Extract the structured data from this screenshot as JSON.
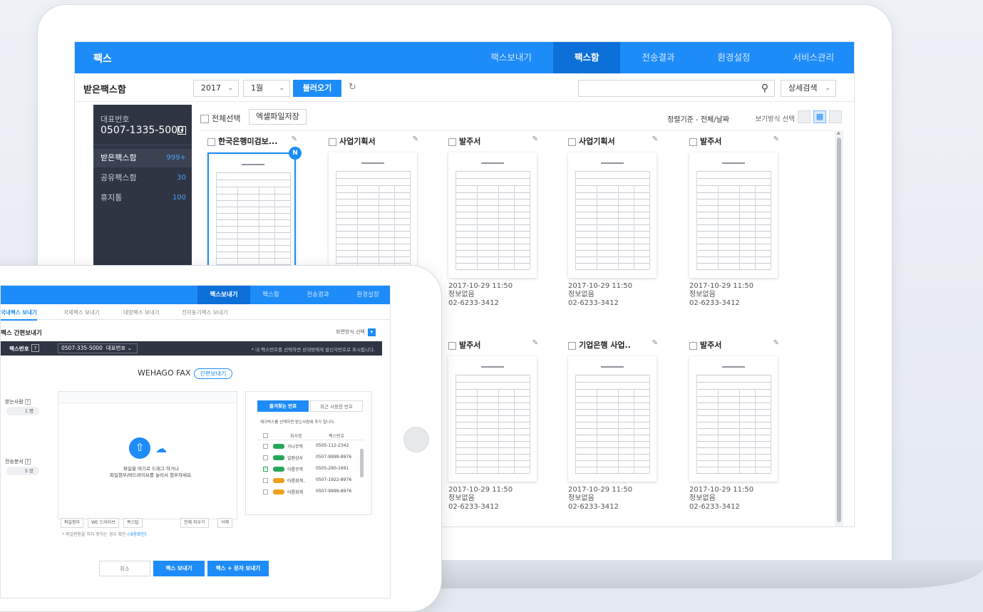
{
  "app": {
    "brand": "팩스",
    "nav": [
      "팩스보내기",
      "팩스함",
      "전송결과",
      "환경설정",
      "서비스관리"
    ],
    "nav_active": "팩스함"
  },
  "toolbar": {
    "title": "받은팩스함",
    "year": "2017",
    "month": "1월",
    "load_button": "불러오기",
    "search_placeholder": "",
    "advanced": "상세검색"
  },
  "sidebar": {
    "label": "대표번호",
    "number": "0507-1335-5000",
    "items": [
      {
        "label": "받은팩스함",
        "count": "999+"
      },
      {
        "label": "공유팩스함",
        "count": "30"
      },
      {
        "label": "휴지통",
        "count": "100"
      }
    ]
  },
  "content": {
    "select_all": "전체선택",
    "excel_button": "엑셀파일저장",
    "sort_label": "정렬기준 - 전체/날짜",
    "view_label": "보기방식 선택"
  },
  "cards": [
    {
      "title": "한국은행미검보...",
      "date": "",
      "sender": "",
      "phone": "",
      "selected": true,
      "badge": "N"
    },
    {
      "title": "사업기획서",
      "date": "",
      "sender": "",
      "phone": ""
    },
    {
      "title": "발주서",
      "date": "2017-10-29 11:50",
      "sender": "정보없음",
      "phone": "02-6233-3412"
    },
    {
      "title": "사업기획서",
      "date": "2017-10-29 11:50",
      "sender": "정보없음",
      "phone": "02-6233-3412"
    },
    {
      "title": "발주서",
      "date": "2017-10-29 11:50",
      "sender": "정보없음",
      "phone": "02-6233-3412"
    },
    {
      "title": "발주서",
      "date": "2017-10-29 11:50",
      "sender": "정보없음",
      "phone": "02-6233-3412"
    },
    {
      "title": "기업은행 사업..",
      "date": "2017-10-29 11:50",
      "sender": "정보없음",
      "phone": "02-6233-3412"
    },
    {
      "title": "발주서",
      "date": "2017-10-29 11:50",
      "sender": "정보없음",
      "phone": "02-6233-3412"
    }
  ],
  "tablet": {
    "nav": [
      "팩스보내기",
      "팩스함",
      "전송결과",
      "환경설정"
    ],
    "tabs": [
      "국내팩스 보내기",
      "국제팩스 보내기",
      "대량팩스 보내기",
      "전자동기팩스 보내기"
    ],
    "section_title": "팩스 간편보내기",
    "view_toggle": "화면방식 선택",
    "sender_label": "팩스번호",
    "sender_value": "0507-335-5000",
    "sender_type": "대표번호",
    "sender_notice": "* 내 팩스번호를 선택하면 상대방에게 발신자번호로 표시됩니다.",
    "brand": "WEHAGO FAX",
    "brand_badge": "간편보내기",
    "recipient_label": "받는사람",
    "recipient_count": "1 명",
    "pages_label": "전송분서",
    "pages_count": "5 장",
    "drop_text_1": "파일을 여기로 드래그 하거나",
    "drop_text_2": "파일첨부/버드라이브를 눌러서 첨부하세요.",
    "file_buttons": [
      "파일첨부",
      "WE 드라이브",
      "목스탑",
      "전체 지우기",
      "삭제"
    ],
    "note": "* 파일변환을 하지 못하는 경우 확인",
    "note_link": "(내용확인)",
    "panel_tab_on": "즐겨찾는 번호",
    "panel_tab_off": "최근 사용한 번호",
    "panel_info": "체크박스를 선택하면 받는사람에 추가 됩니다.",
    "panel_cols": [
      "회사명",
      "팩스번호"
    ],
    "panel_rows": [
      {
        "name": "가나무역",
        "phone": "0505-112-2342",
        "checked": false
      },
      {
        "name": "일원상사",
        "phone": "0507-9999-8976",
        "checked": false
      },
      {
        "name": "아름무역",
        "phone": "0505-290-1691",
        "checked": true
      },
      {
        "name": "아름회계..",
        "phone": "0507-1922-8976",
        "checked": false
      },
      {
        "name": "아름회계",
        "phone": "0507-9999-8976",
        "checked": false
      }
    ],
    "btn_cancel": "취소",
    "btn_send": "팩스 보내기",
    "btn_send_sms": "팩스 + 문자 보내기"
  },
  "colors": {
    "accent": "#1d8cf8",
    "sidebar": "#2f3543"
  }
}
